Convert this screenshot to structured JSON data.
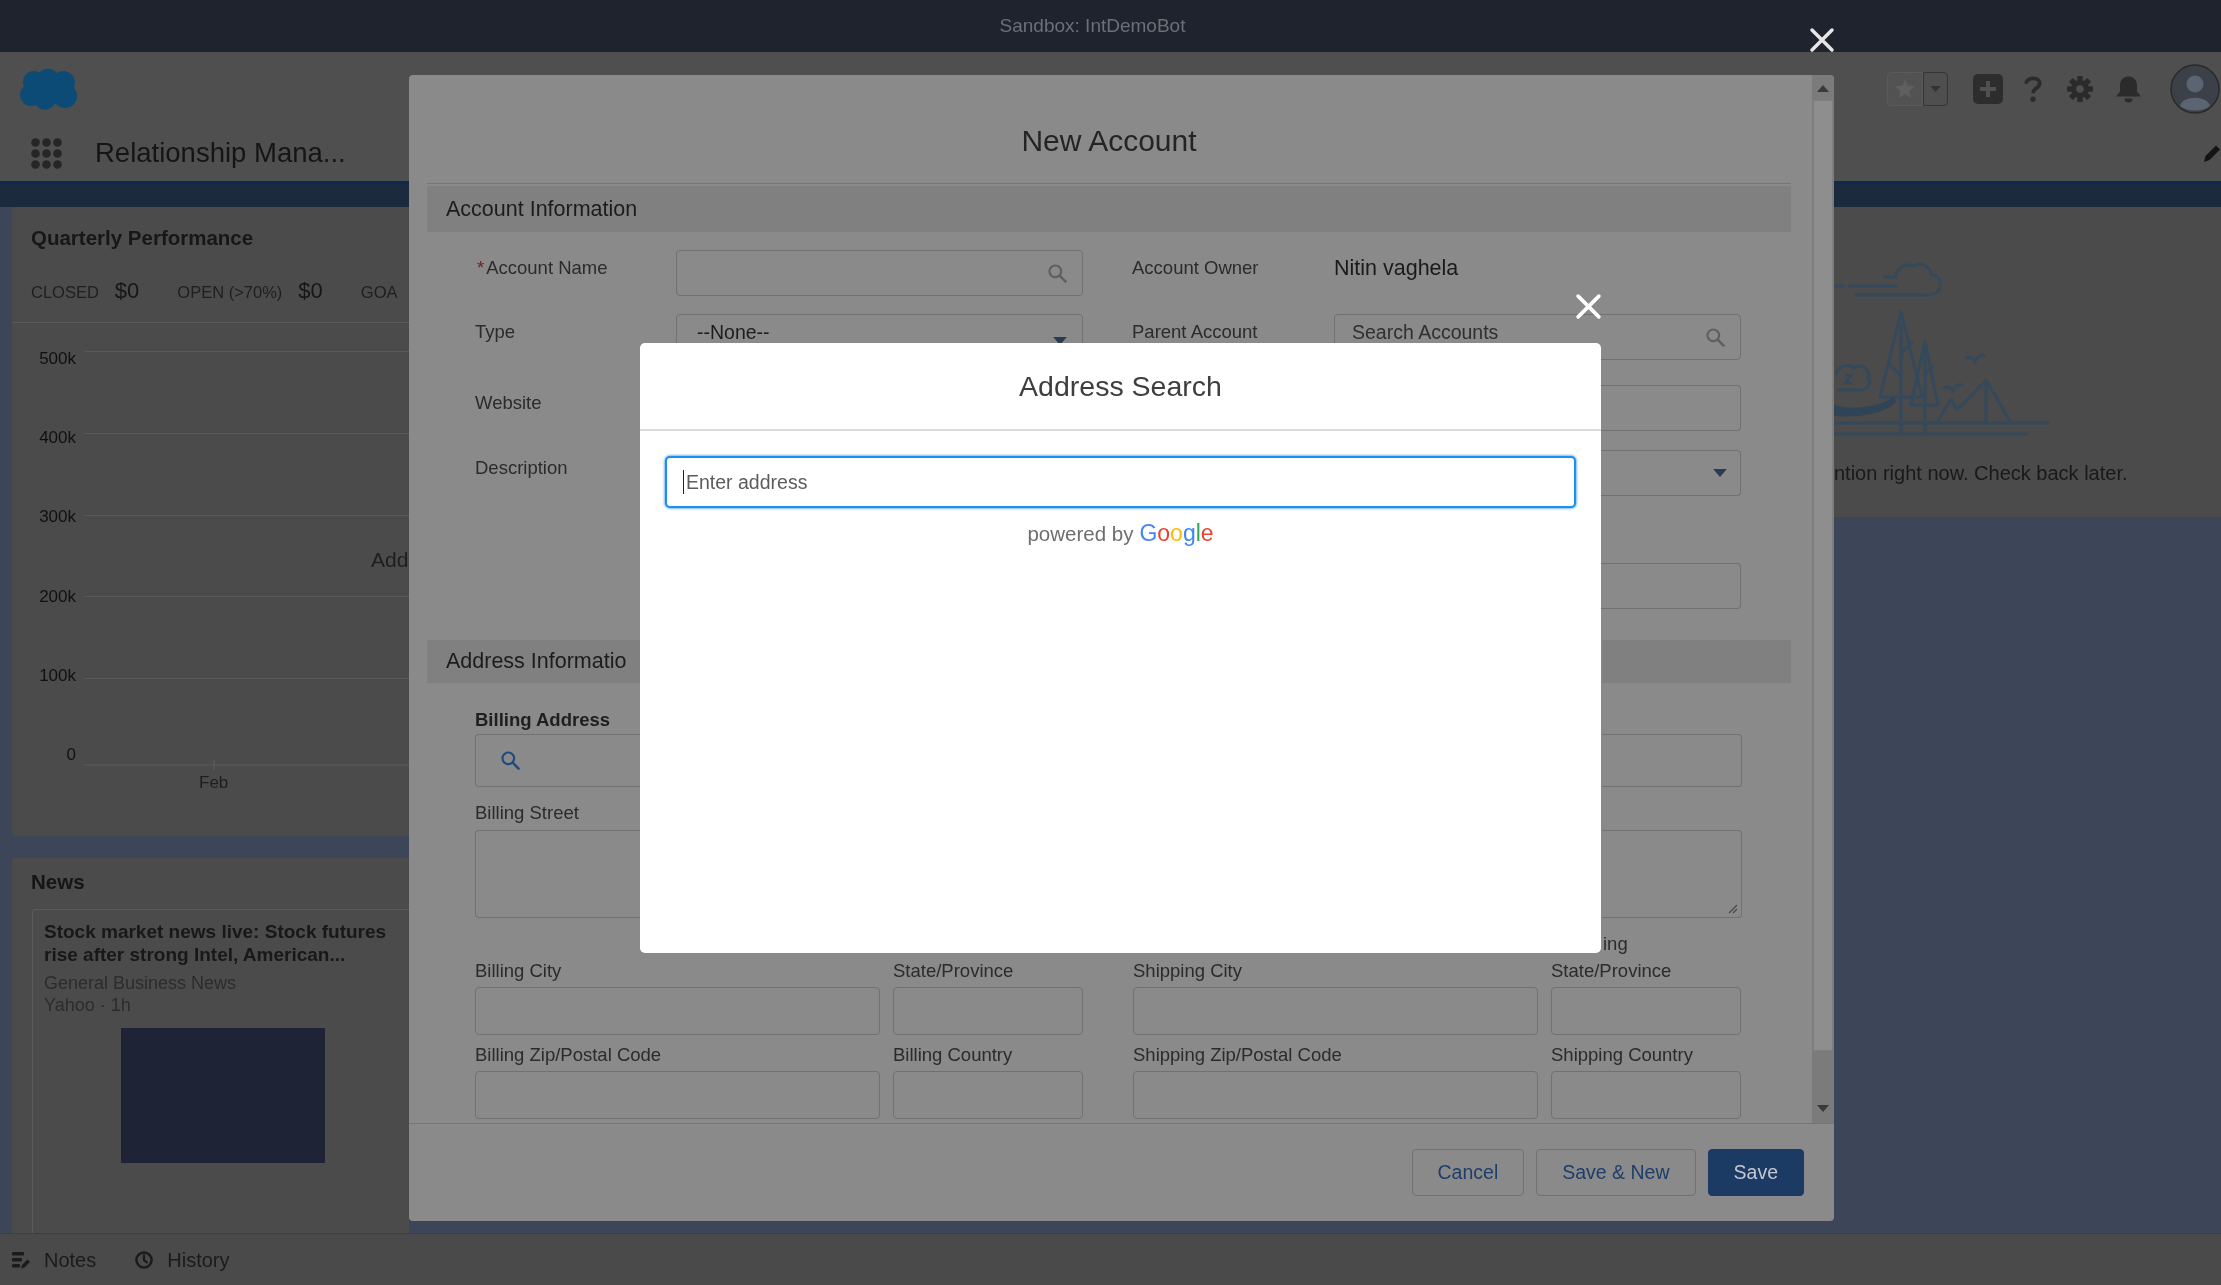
{
  "system_bar": {
    "title": "Sandbox: IntDemoBot"
  },
  "header": {
    "app_name": "Relationship Mana..."
  },
  "quarterly_performance": {
    "title": "Quarterly Performance",
    "metrics": [
      {
        "label": "CLOSED",
        "value": "$0"
      },
      {
        "label": "OPEN (>70%)",
        "value": "$0"
      },
      {
        "label": "GOA"
      }
    ],
    "y_axis_labels": [
      "500k",
      "400k",
      "300k",
      "200k",
      "100k",
      "0"
    ],
    "x_axis_labels": [
      "Feb"
    ],
    "message": "Add"
  },
  "news": {
    "title": "News",
    "articles": [
      {
        "headline": "Stock market news live: Stock futures rise after strong Intel, American...",
        "category": "General Business News",
        "source": "Yahoo · 1h"
      }
    ]
  },
  "empty_state_card": {
    "message": "ntion right now. Check back later."
  },
  "utility_bar": {
    "items": [
      {
        "label": "Notes",
        "kind": "notes"
      },
      {
        "label": "History",
        "kind": "history"
      }
    ]
  },
  "new_account_modal": {
    "title": "New Account",
    "account_information": {
      "title": "Account Information",
      "rows": [
        {
          "left": {
            "label": "Account Name",
            "marker": "*",
            "kind": "search"
          },
          "right": {
            "label": "Account Owner",
            "kind": "value",
            "value": "Nitin vaghela"
          }
        },
        {
          "left": {
            "label": "Type",
            "kind": "select",
            "value": "--None--"
          },
          "right": {
            "label": "Parent Account",
            "kind": "search",
            "placeholder": "Search Accounts"
          }
        },
        {
          "left": {
            "label": "Website"
          },
          "right": {
            "kind": "text"
          }
        },
        {
          "left": {
            "label": "Description"
          },
          "right": {
            "kind": "select"
          }
        },
        {
          "right": {
            "kind": "text"
          }
        }
      ]
    },
    "address_information": {
      "title": "Address Informatio",
      "upper_rows": [
        {
          "left": {
            "label": "Billing Address",
            "kind": "search"
          },
          "right": {
            "kind": "text"
          }
        },
        {
          "left": {
            "label": "Billing Street",
            "kind": "textarea"
          },
          "right": {
            "kind": "textarea"
          }
        }
      ],
      "lower_rows": [
        [
          {
            "label": "Billing City"
          },
          {
            "label": "State/Province"
          },
          {
            "label": "Shipping City"
          },
          {
            "label_above": "ing",
            "label": "State/Province"
          }
        ],
        [
          {
            "label": "Billing Zip/Postal Code"
          },
          {
            "label": "Billing Country"
          },
          {
            "label": "Shipping Zip/Postal Code"
          },
          {
            "label": "Shipping Country"
          }
        ]
      ]
    },
    "buttons": [
      {
        "label": "Cancel",
        "kind": "neutral"
      },
      {
        "label": "Save & New",
        "kind": "neutral"
      },
      {
        "label": "Save",
        "kind": "brand"
      }
    ]
  },
  "address_search_modal": {
    "title": "Address Search",
    "search": {
      "placeholder": "Enter address",
      "focused": true
    },
    "attribution": {
      "text": "powered by",
      "logo": "Google"
    }
  }
}
